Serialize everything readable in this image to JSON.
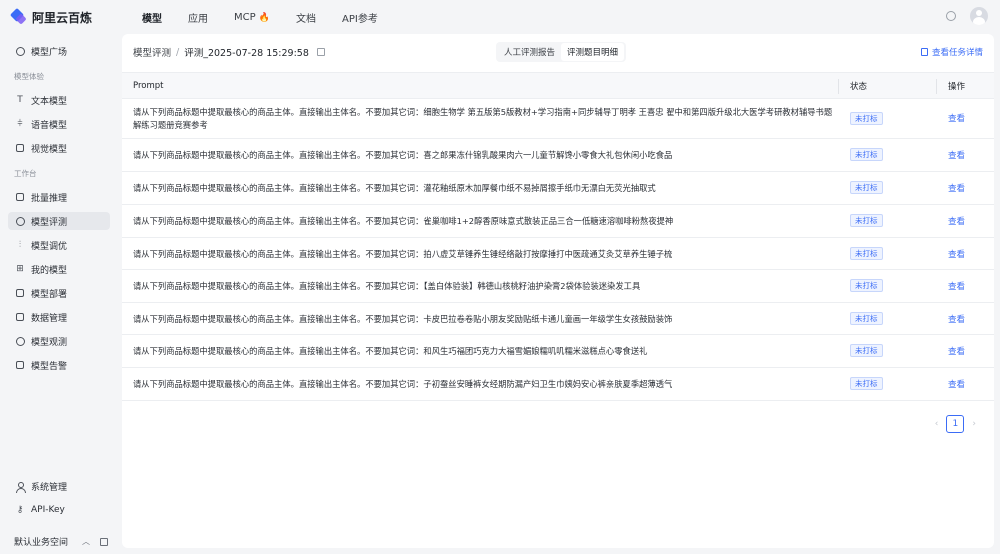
{
  "app": {
    "name": "阿里云百炼"
  },
  "top_nav": [
    {
      "label": "模型",
      "active": true
    },
    {
      "label": "应用",
      "active": false
    },
    {
      "label": "MCP",
      "active": false,
      "badge_icon": "fire-icon"
    },
    {
      "label": "文档",
      "active": false
    },
    {
      "label": "API参考",
      "active": false
    }
  ],
  "sidebar": {
    "plaza": "模型广场",
    "group_experience": "模型体验",
    "experience_items": [
      "文本模型",
      "语音模型",
      "视觉模型"
    ],
    "group_workbench": "工作台",
    "workbench_items": [
      "批量推理",
      "模型评测",
      "模型调优",
      "我的模型",
      "模型部署",
      "数据管理",
      "模型观测",
      "模型告警"
    ],
    "active_item": "模型评测",
    "bottom_items": [
      "系统管理",
      "API-Key"
    ],
    "workspace": "默认业务空间"
  },
  "header": {
    "breadcrumb_root": "模型评测",
    "breadcrumb_sep": "/",
    "breadcrumb_current": "评测_2025-07-28 15:29:58",
    "tabs": [
      {
        "label": "人工评测报告",
        "active": false
      },
      {
        "label": "评测题目明细",
        "active": true
      }
    ],
    "detail_link": "查看任务详情"
  },
  "table": {
    "columns": {
      "prompt": "Prompt",
      "status": "状态",
      "ops": "操作"
    },
    "rows": [
      {
        "prompt": "请从下列商品标题中提取最核心的商品主体。直接输出主体名。不要加其它词：细胞生物学 第五版第5版教材+学习指南+同步辅导丁明孝 王喜忠 翟中和第四版升级北大医学考研教材辅导书题解练习题册竞赛参考",
        "status": "未打标",
        "action": "查看"
      },
      {
        "prompt": "请从下列商品标题中提取最核心的商品主体。直接输出主体名。不要加其它词：喜之郎果冻什锦乳酸果肉六一儿童节解馋小零食大礼包休闲小吃食品",
        "status": "未打标",
        "action": "查看"
      },
      {
        "prompt": "请从下列商品标题中提取最核心的商品主体。直接输出主体名。不要加其它词：灌花釉纸原木加厚餐巾纸不易掉屑擦手纸巾无漂白无荧光抽取式",
        "status": "未打标",
        "action": "查看"
      },
      {
        "prompt": "请从下列商品标题中提取最核心的商品主体。直接输出主体名。不要加其它词：雀巢咖啡1+2醇香原味意式散装正品三合一低糖速溶咖啡粉熬夜提神",
        "status": "未打标",
        "action": "查看"
      },
      {
        "prompt": "请从下列商品标题中提取最核心的商品主体。直接输出主体名。不要加其它词：拍八虚艾草锤养生锤经络敲打按摩捶打中医疏通艾灸艾草养生锤子梳",
        "status": "未打标",
        "action": "查看"
      },
      {
        "prompt": "请从下列商品标题中提取最核心的商品主体。直接输出主体名。不要加其它词：【盖白体验装】韩德山核桃籽油护染膏2袋体验装迷染发工具",
        "status": "未打标",
        "action": "查看"
      },
      {
        "prompt": "请从下列商品标题中提取最核心的商品主体。直接输出主体名。不要加其它词：卡皮巴拉卷卷贴小朋友奖励贴纸卡通儿童画一年级学生女孩鼓励装饰",
        "status": "未打标",
        "action": "查看"
      },
      {
        "prompt": "请从下列商品标题中提取最核心的商品主体。直接输出主体名。不要加其它词：和风生巧福团巧克力大福雪媚娘糯叽叽糯米滋糕点心零食送礼",
        "status": "未打标",
        "action": "查看"
      },
      {
        "prompt": "请从下列商品标题中提取最核心的商品主体。直接输出主体名。不要加其它词：子初蚕丝安睡裤女经期防漏产妇卫生巾姨妈安心裤亲肤夏季超薄透气",
        "status": "未打标",
        "action": "查看"
      }
    ]
  },
  "pagination": {
    "prev": "‹",
    "current": "1",
    "next": "›"
  },
  "colors": {
    "accent": "#3b6cf6",
    "badge_bg": "#eef3ff"
  }
}
